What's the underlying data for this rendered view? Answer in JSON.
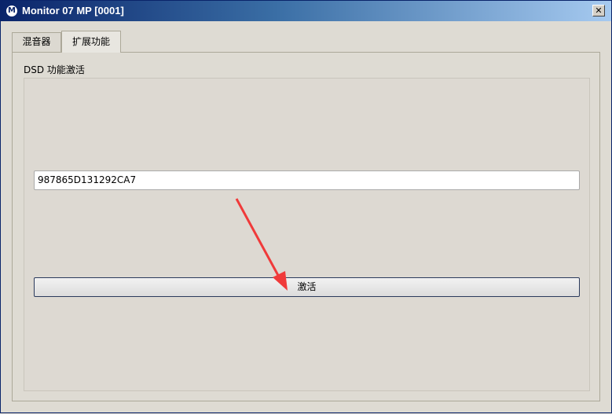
{
  "window": {
    "title": "Monitor 07 MP [0001]",
    "app_icon_glyph": "M",
    "close_glyph": "✕"
  },
  "tabs": [
    {
      "label": "混音器",
      "selected": false
    },
    {
      "label": "扩展功能",
      "selected": true
    }
  ],
  "dsd": {
    "group_label": "DSD 功能激活",
    "code_value": "987865D131292CA7",
    "activate_label": "激活"
  },
  "colors": {
    "annotation_arrow": "#f03a3a"
  }
}
